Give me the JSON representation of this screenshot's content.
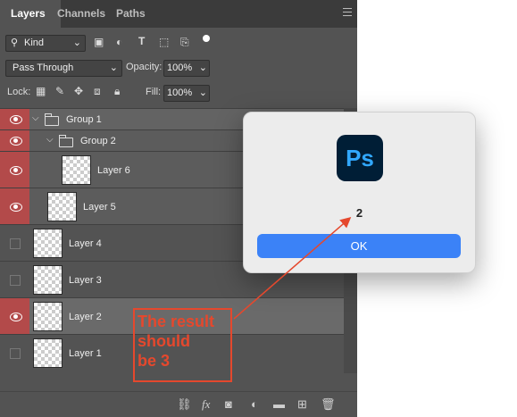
{
  "tabs": [
    "Layers",
    "Channels",
    "Paths"
  ],
  "filter": {
    "kind_label": "Kind"
  },
  "blend": {
    "mode": "Pass Through",
    "opacity_label": "Opacity:",
    "opacity_value": "100%"
  },
  "lock": {
    "label": "Lock:",
    "fill_label": "Fill:",
    "fill_value": "100%"
  },
  "layers": [
    {
      "name": "Group 1",
      "visible": true,
      "type": "group"
    },
    {
      "name": "Group 2",
      "visible": true,
      "type": "group"
    },
    {
      "name": "Layer 6",
      "visible": true,
      "type": "layer"
    },
    {
      "name": "Layer 5",
      "visible": true,
      "type": "layer"
    },
    {
      "name": "Layer 4",
      "visible": false,
      "type": "layer"
    },
    {
      "name": "Layer 3",
      "visible": false,
      "type": "layer"
    },
    {
      "name": "Layer 2",
      "visible": true,
      "type": "layer",
      "selected": true
    },
    {
      "name": "Layer 1",
      "visible": false,
      "type": "layer"
    }
  ],
  "dialog": {
    "app_logo": "Ps",
    "message": "2",
    "ok_label": "OK"
  },
  "annotation": {
    "text": "The result\nshould\nbe 3",
    "color": "#e5482d"
  },
  "bottom_icons": [
    "link-icon",
    "fx-icon",
    "mask-icon",
    "adjustment-icon",
    "folder-icon",
    "new-layer-icon",
    "trash-icon"
  ]
}
